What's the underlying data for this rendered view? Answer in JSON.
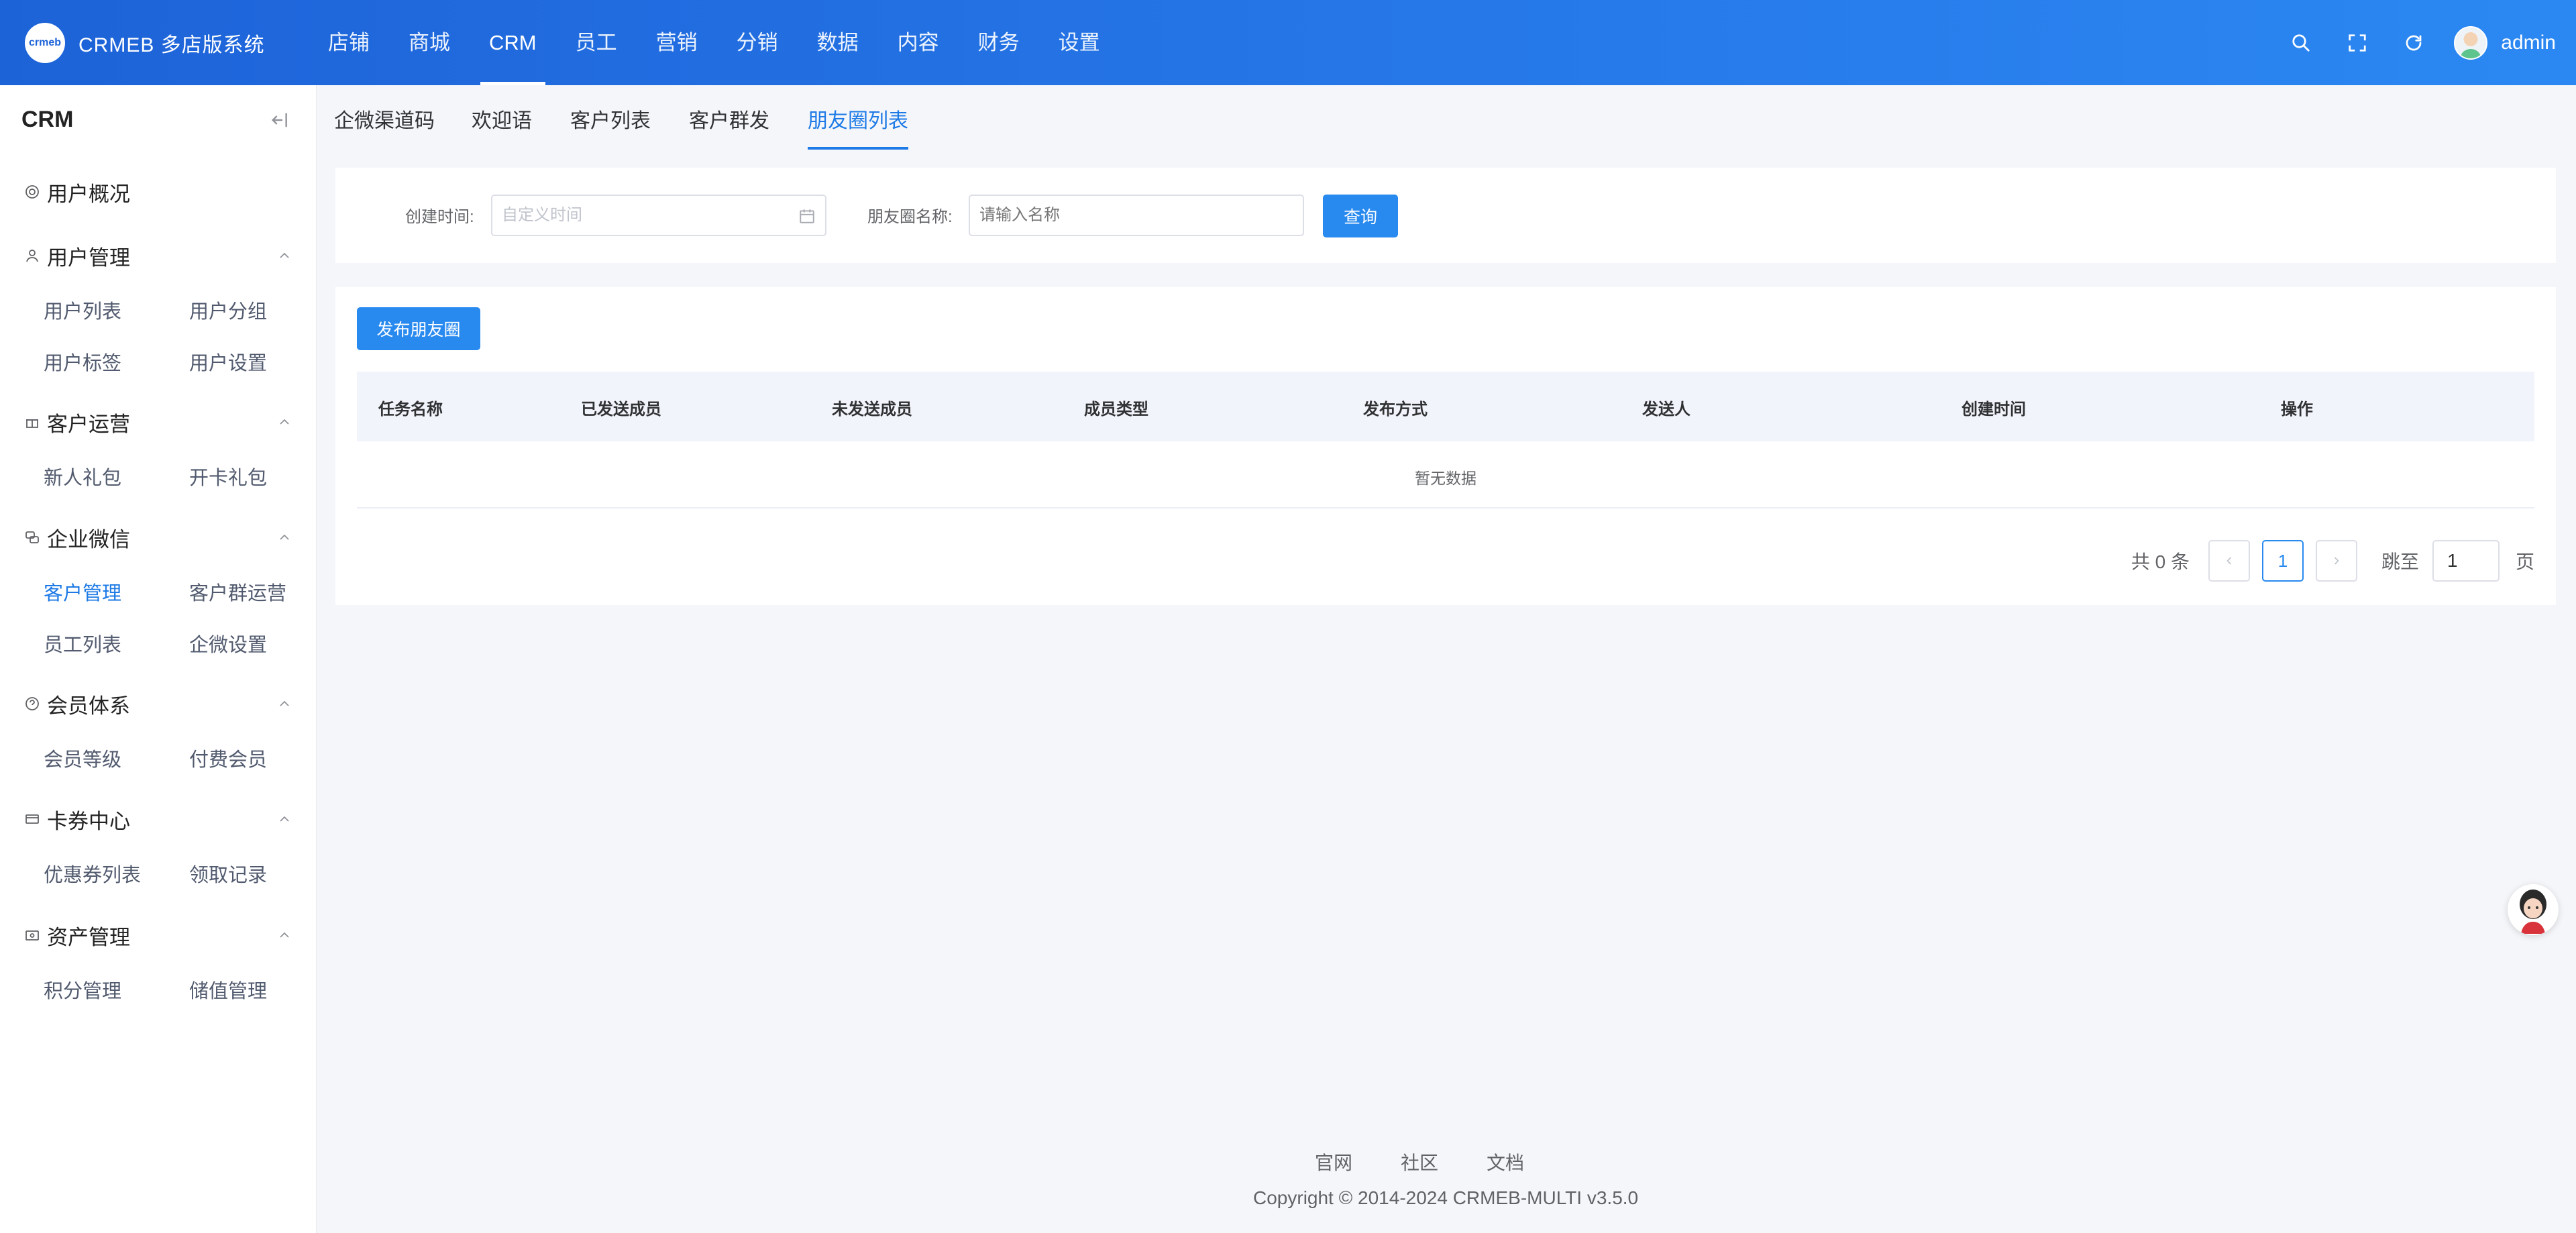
{
  "app": {
    "logo_text": "crmeb",
    "title": "CRMEB 多店版系统"
  },
  "topnav": [
    {
      "label": "店铺"
    },
    {
      "label": "商城"
    },
    {
      "label": "CRM",
      "active": true
    },
    {
      "label": "员工"
    },
    {
      "label": "营销"
    },
    {
      "label": "分销"
    },
    {
      "label": "数据"
    },
    {
      "label": "内容"
    },
    {
      "label": "财务"
    },
    {
      "label": "设置"
    }
  ],
  "header": {
    "username": "admin",
    "tools": [
      "search-icon",
      "fullscreen-icon",
      "refresh-icon"
    ]
  },
  "sidebar": {
    "title": "CRM",
    "overview": "用户概况",
    "groups": [
      {
        "label": "用户管理",
        "icon": "user-icon",
        "items": [
          "用户列表",
          "用户分组",
          "用户标签",
          "用户设置"
        ]
      },
      {
        "label": "客户运营",
        "icon": "gift-icon",
        "items": [
          "新人礼包",
          "开卡礼包"
        ]
      },
      {
        "label": "企业微信",
        "icon": "chat-icon",
        "items": [
          "客户管理",
          "客户群运营",
          "员工列表",
          "企微设置"
        ],
        "active_item": "客户管理"
      },
      {
        "label": "会员体系",
        "icon": "member-icon",
        "items": [
          "会员等级",
          "付费会员"
        ]
      },
      {
        "label": "卡券中心",
        "icon": "card-icon",
        "items": [
          "优惠券列表",
          "领取记录"
        ]
      },
      {
        "label": "资产管理",
        "icon": "wallet-icon",
        "items": [
          "积分管理",
          "储值管理"
        ]
      }
    ]
  },
  "tabs": [
    {
      "label": "企微渠道码"
    },
    {
      "label": "欢迎语"
    },
    {
      "label": "客户列表"
    },
    {
      "label": "客户群发"
    },
    {
      "label": "朋友圈列表",
      "active": true
    }
  ],
  "filters": {
    "created_time_label": "创建时间:",
    "created_time_placeholder": "自定义时间",
    "name_label": "朋友圈名称:",
    "name_placeholder": "请输入名称",
    "query_button": "查询"
  },
  "table": {
    "publish_button": "发布朋友圈",
    "columns": [
      "任务名称",
      "已发送成员",
      "未发送成员",
      "成员类型",
      "发布方式",
      "发送人",
      "创建时间",
      "操作"
    ],
    "empty_text": "暂无数据"
  },
  "pagination": {
    "total_text": "共 0 条",
    "current_page": "1",
    "jump_label": "跳至",
    "jump_value": "1",
    "page_unit": "页"
  },
  "footer": {
    "links": [
      "官网",
      "社区",
      "文档"
    ],
    "copyright": "Copyright © 2014-2024 CRMEB-MULTI v3.5.0"
  },
  "colors": {
    "header_start": "#1d63d8",
    "header_end": "#2b88f2",
    "accent": "#1d7ae6",
    "button": "#2889ef"
  }
}
